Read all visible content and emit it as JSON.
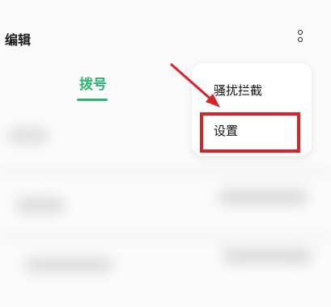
{
  "header": {
    "edit_label": "编辑",
    "more_icon": "more-vertical-icon"
  },
  "tabs": [
    {
      "label": "拨号",
      "active": true
    }
  ],
  "menu": {
    "items": [
      {
        "label": "骚扰拦截"
      },
      {
        "label": "设置",
        "highlighted": true
      }
    ]
  },
  "colors": {
    "accent": "#2db573",
    "highlight": "#d6242b",
    "background": "#fbfbfb"
  }
}
